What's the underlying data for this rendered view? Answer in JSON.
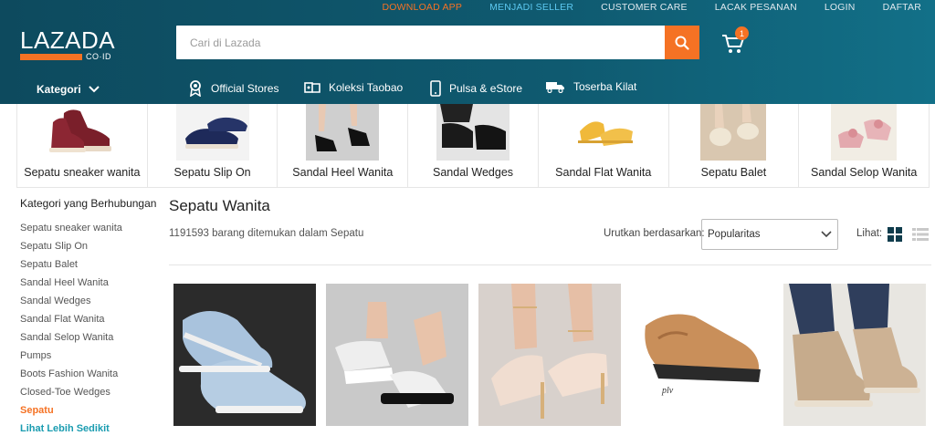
{
  "topbar": {
    "links": [
      "DOWNLOAD APP",
      "MENJADI SELLER",
      "CUSTOMER CARE",
      "LACAK PESANAN",
      "LOGIN",
      "DAFTAR"
    ]
  },
  "logo": {
    "name": "LAZADA",
    "domain": "CO·ID"
  },
  "search": {
    "placeholder": "Cari di Lazada"
  },
  "cart": {
    "count": "1"
  },
  "nav": {
    "kategori": "Kategori",
    "items": [
      "Official Stores",
      "Koleksi Taobao",
      "Pulsa & eStore",
      "Toserba Kilat"
    ]
  },
  "categories": [
    "Sepatu sneaker wanita",
    "Sepatu Slip On",
    "Sandal Heel Wanita",
    "Sandal Wedges",
    "Sandal Flat Wanita",
    "Sepatu Balet",
    "Sandal Selop Wanita"
  ],
  "sidebar": {
    "title": "Kategori yang Berhubungan",
    "items": [
      "Sepatu sneaker wanita",
      "Sepatu Slip On",
      "Sepatu Balet",
      "Sandal Heel Wanita",
      "Sandal Wedges",
      "Sandal Flat Wanita",
      "Sandal Selop Wanita",
      "Pumps",
      "Boots Fashion Wanita",
      "Closed-Toe Wedges",
      "Sepatu"
    ],
    "more": "Lihat Lebih Sedikit"
  },
  "main": {
    "title": "Sepatu Wanita",
    "count": "1191593 barang ditemukan dalam Sepatu",
    "sort_label": "Urutkan berdasarkan:",
    "sort_value": "Popularitas",
    "view_label": "Lihat:"
  },
  "colors": {
    "accent": "#f57224",
    "header": "#0f5a70",
    "link": "#1a9cb0"
  }
}
